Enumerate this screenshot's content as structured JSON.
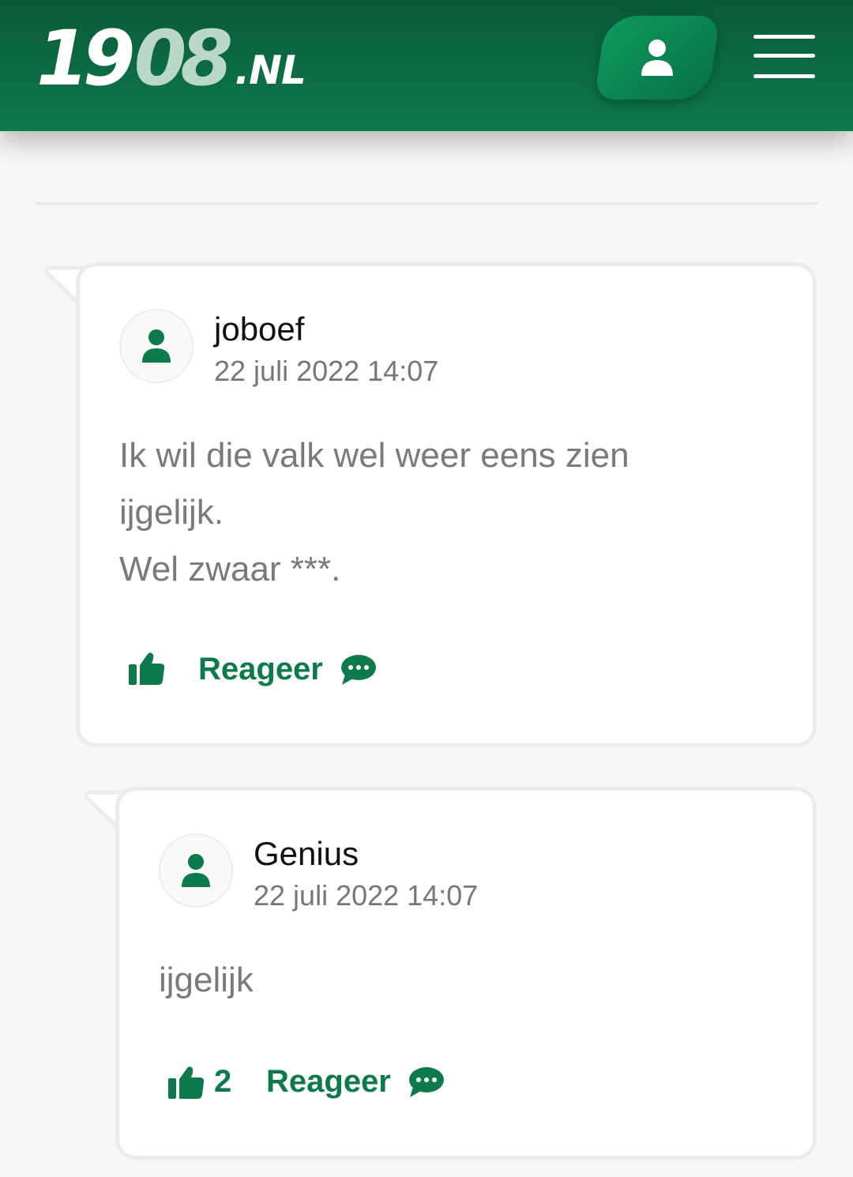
{
  "header": {
    "logo": {
      "part1": "19",
      "part2": "08",
      "part3": ".NL"
    },
    "account_icon": "user-icon",
    "menu_icon": "hamburger-menu-icon"
  },
  "comments": [
    {
      "username": "joboef",
      "timestamp": "22 juli 2022 14:07",
      "lines": [
        "Ik wil die valk wel weer eens zien",
        "ijgelijk.",
        "Wel zwaar ***."
      ],
      "like_count": "",
      "reply_label": "Reageer"
    },
    {
      "username": "Genius",
      "timestamp": "22 juli 2022 14:07",
      "lines": [
        "ijgelijk"
      ],
      "like_count": "2",
      "reply_label": "Reageer"
    }
  ],
  "colors": {
    "brand_green": "#0d7a4b",
    "header_dark": "#0a5a36",
    "text_gray": "#7a7a7a"
  }
}
